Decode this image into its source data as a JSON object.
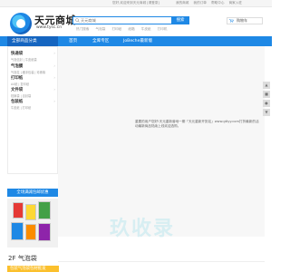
{
  "topbar": {
    "greeting": "您好,欢迎来到天元商城 [请登录]",
    "links": [
      "我的商城",
      "我的订单",
      "帮助中心",
      "商家入驻"
    ]
  },
  "logo": {
    "title": "天元商城",
    "url": "www.tysc.cn"
  },
  "search": {
    "placeholder": "天元商城",
    "button_label": "搜索",
    "hot_words": [
      "热门搜索",
      "气泡袋",
      "打印纸",
      "纸箱",
      "牛皮纸",
      "打印机"
    ]
  },
  "cart": {
    "label": "购物车"
  },
  "nav": {
    "all_label": "全部商品分类",
    "items": [
      "首页",
      "全库专区",
      "JoBeche最新版"
    ]
  },
  "sidebar": {
    "categories": [
      {
        "title": "快递袋",
        "sub": "气泡信封 | 牛皮纸袋"
      },
      {
        "title": "气泡膜",
        "sub": "气泡柱 | 缓冲包装 | 珍珠棉"
      },
      {
        "title": "打印纸",
        "sub": "A4纸 | 复印纸"
      },
      {
        "title": "文件袋",
        "sub": "档案袋 | 自封袋"
      },
      {
        "title": "包装纸",
        "sub": "牛皮纸 | 打印纸"
      }
    ]
  },
  "hero": {
    "notice": "重要的用户您好!天元重新营地一期「天元重新开张站」www.gttyy.com打折最新的活动最新商品陆续上线欢迎选购。"
  },
  "promo": {
    "banner_label": "全场满减包邮优惠"
  },
  "watermark": "玖收录",
  "floor": {
    "title": "2F 气泡袋",
    "bar_label": "包装气泡袋包材批发"
  },
  "colors": {
    "brand_blue": "#1e88e5",
    "brand_yellow": "#fbc02d"
  }
}
